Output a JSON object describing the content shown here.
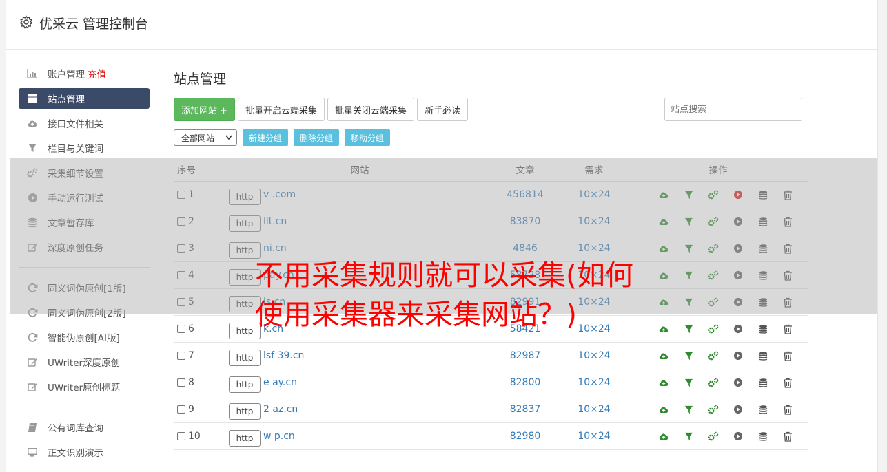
{
  "app": {
    "title": "优采云 管理控制台"
  },
  "sidebar": {
    "items": [
      {
        "label": "账户管理",
        "icon": "bar-chart-icon",
        "extra": "充值"
      },
      {
        "label": "站点管理",
        "icon": "server-icon",
        "active": true
      },
      {
        "label": "接口文件相关",
        "icon": "cloud-upload-icon"
      },
      {
        "label": "栏目与关键词",
        "icon": "filter-icon"
      },
      {
        "label": "采集细节设置",
        "icon": "gears-icon"
      },
      {
        "label": "手动运行测试",
        "icon": "play-circle-icon"
      },
      {
        "label": "文章暂存库",
        "icon": "database-icon"
      },
      {
        "label": "深度原创任务",
        "icon": "edit-icon"
      },
      {
        "label": "同义词伪原创[1版]",
        "icon": "refresh-icon"
      },
      {
        "label": "同义词伪原创[2版]",
        "icon": "refresh-icon"
      },
      {
        "label": "智能伪原创[AI版]",
        "icon": "refresh-icon"
      },
      {
        "label": "UWriter深度原创",
        "icon": "edit-icon"
      },
      {
        "label": "UWriter原创标题",
        "icon": "edit-icon"
      },
      {
        "label": "公有词库查询",
        "icon": "book-icon"
      },
      {
        "label": "正文识别演示",
        "icon": "monitor-icon"
      }
    ]
  },
  "main": {
    "title": "站点管理",
    "buttons": {
      "add_site": "添加网站 +",
      "batch_open": "批量开启云端采集",
      "batch_close": "批量关闭云端采集",
      "newbie": "新手必读"
    },
    "search_placeholder": "站点搜索",
    "group_select": "全部网站",
    "group_buttons": {
      "new": "新建分组",
      "delete": "删除分组",
      "move": "移动分组"
    },
    "table": {
      "headers": {
        "no": "序号",
        "site": "网站",
        "articles": "文章",
        "demand": "需求",
        "ops": "操作"
      },
      "http_label": "http",
      "rows": [
        {
          "no": "1",
          "domain": "v          .com",
          "articles": "456814",
          "demand": "10×24",
          "play_active": true
        },
        {
          "no": "2",
          "domain": "      llt.cn",
          "articles": "83870",
          "demand": "10×24"
        },
        {
          "no": "3",
          "domain": "       ni.cn",
          "articles": "4846",
          "demand": "10×24"
        },
        {
          "no": "4",
          "domain": "      pay.cn",
          "articles": "58728",
          "demand": "10×24"
        },
        {
          "no": "5",
          "domain": "      ls.cn",
          "articles": "82991",
          "demand": "10×24"
        },
        {
          "no": "6",
          "domain": "     k.cn",
          "articles": "58421",
          "demand": "10×24"
        },
        {
          "no": "7",
          "domain": "lsf  39.cn",
          "articles": "82987",
          "demand": "10×24"
        },
        {
          "no": "8",
          "domain": "e     ay.cn",
          "articles": "82800",
          "demand": "10×24"
        },
        {
          "no": "9",
          "domain": "2     az.cn",
          "articles": "82837",
          "demand": "10×24"
        },
        {
          "no": "10",
          "domain": "w     p.cn",
          "articles": "82980",
          "demand": "10×24"
        }
      ]
    }
  },
  "overlay": {
    "headline": "不用采集规则就可以采集(如何使用采集器来采集网站？)"
  },
  "colors": {
    "green": "#2e8b2e",
    "red": "#e02020",
    "link": "#337ab7",
    "active_nav": "#3b4a66"
  }
}
